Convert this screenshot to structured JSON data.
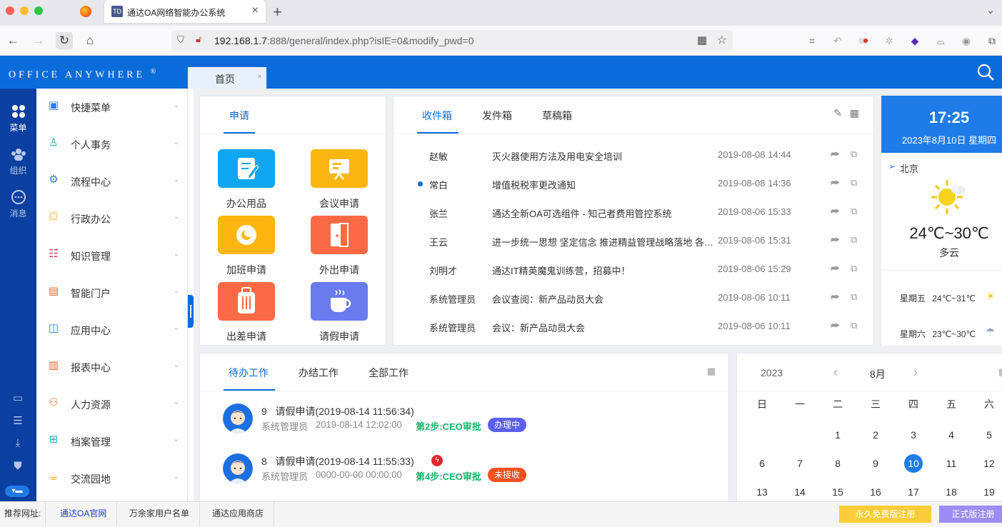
{
  "browser": {
    "tab_title": "通达OA网络智能办公系统",
    "tab_favicon": "TD",
    "url_host": "192.168.1.7",
    "url_rest": ":888/general/index.php?isIE=0&modify_pwd=0"
  },
  "header": {
    "brand": "Office Anywhere",
    "brand_mark": "®",
    "home_tab": "首页",
    "home_tab_close": "×"
  },
  "rail": {
    "menu": "菜单",
    "org": "组织",
    "msg": "消息"
  },
  "menu": [
    {
      "label": "快捷菜单",
      "icon": "grid-icon",
      "color": "#2d7be5"
    },
    {
      "label": "个人事务",
      "icon": "person-icon",
      "color": "#19b3a6"
    },
    {
      "label": "流程中心",
      "icon": "workflow-icon",
      "color": "#2d7be5"
    },
    {
      "label": "行政办公",
      "icon": "briefcase-icon",
      "color": "#f2a20c"
    },
    {
      "label": "知识管理",
      "icon": "book-icon",
      "color": "#e6284a"
    },
    {
      "label": "智能门户",
      "icon": "portal-icon",
      "color": "#e5642a"
    },
    {
      "label": "应用中心",
      "icon": "app-icon",
      "color": "#2d7be5"
    },
    {
      "label": "报表中心",
      "icon": "chart-icon",
      "color": "#e5642a"
    },
    {
      "label": "人力资源",
      "icon": "people-icon",
      "color": "#e5642a"
    },
    {
      "label": "档案管理",
      "icon": "archive-icon",
      "color": "#19b3a6"
    },
    {
      "label": "交流园地",
      "icon": "cup-icon",
      "color": "#f2a20c"
    }
  ],
  "apply": {
    "tab": "申请",
    "tiles": [
      {
        "label": "办公用品",
        "color": "#10a6f0",
        "icon": "stationery-icon"
      },
      {
        "label": "会议申请",
        "color": "#fcb60f",
        "icon": "meeting-icon"
      },
      {
        "label": "加班申请",
        "color": "#fcb60f",
        "icon": "overtime-icon"
      },
      {
        "label": "外出申请",
        "color": "#fc6a45",
        "icon": "door-icon"
      },
      {
        "label": "出差申请",
        "color": "#fc6a45",
        "icon": "luggage-icon"
      },
      {
        "label": "请假申请",
        "color": "#6a7bf0",
        "icon": "coffee-icon"
      }
    ]
  },
  "mail": {
    "tabs": [
      "收件箱",
      "发件箱",
      "草稿箱"
    ],
    "rows": [
      {
        "from": "赵敏",
        "subject": "灭火器使用方法及用电安全培训",
        "time": "2019-08-08 14:44",
        "unread": false
      },
      {
        "from": "常白",
        "subject": "增值税税率更改通知",
        "time": "2019-08-08 14:36",
        "unread": true
      },
      {
        "from": "张兰",
        "subject": "通达全新OA可选组件 - 知己者费用管控系统",
        "time": "2019-08-06 15:33",
        "unread": false
      },
      {
        "from": "王云",
        "subject": "进一步统一思想 坚定信念 推进精益管理战略落地 各部门积极响应",
        "time": "2019-08-06 15:31",
        "unread": false
      },
      {
        "from": "刘明才",
        "subject": "通达IT精英魔鬼训练营，招募中！",
        "time": "2019-08-06 15:29",
        "unread": false
      },
      {
        "from": "系统管理员",
        "subject": "会议查阅：新产品动员大会",
        "time": "2019-08-06 10:11",
        "unread": false
      },
      {
        "from": "系统管理员",
        "subject": "会议：新产品动员大会",
        "time": "2019-08-06 10:11",
        "unread": false
      }
    ]
  },
  "weather": {
    "time": "17:25",
    "date": "2023年8月10日  星期四",
    "city": "北京",
    "temp": "24℃~30℃",
    "condition": "多云",
    "forecast": [
      {
        "day": "星期五",
        "temp": "24℃~31℃",
        "icon": "sunny-cloud-icon"
      },
      {
        "day": "星期六",
        "temp": "23℃~30℃",
        "icon": "rain-icon"
      }
    ]
  },
  "todo": {
    "tabs": [
      "待办工作",
      "办结工作",
      "全部工作"
    ],
    "items": [
      {
        "num": "9",
        "title": "请假申请(2019-08-14 11:56:34)",
        "user": "系统管理员",
        "time": "2019-08-14 12:02:00",
        "step": "第2步:CEO审批",
        "status": "办理中",
        "status_color": "#5b5ff0",
        "urgent": false
      },
      {
        "num": "8",
        "title": "请假申请(2019-08-14 11:55:33)",
        "user": "系统管理员",
        "time": "0000-00-00 00:00:00",
        "step": "第4步:CEO审批",
        "status": "未接收",
        "status_color": "#f4511e",
        "urgent": true
      }
    ]
  },
  "calendar": {
    "year": "2023",
    "month": "8月",
    "weekdays": [
      "日",
      "一",
      "二",
      "三",
      "四",
      "五",
      "六"
    ],
    "weeks": [
      [
        "",
        "",
        "1",
        "2",
        "3",
        "4",
        "5"
      ],
      [
        "6",
        "7",
        "8",
        "9",
        "10",
        "11",
        "12"
      ],
      [
        "13",
        "14",
        "15",
        "16",
        "17",
        "18",
        "19"
      ]
    ],
    "today": "10"
  },
  "footer": {
    "label": "推荐网址:",
    "links": [
      "通达OA官网",
      "万余家用户名单",
      "通达应用商店"
    ],
    "free_button": "永久免费版注册",
    "pro_button": "正式版注册"
  }
}
